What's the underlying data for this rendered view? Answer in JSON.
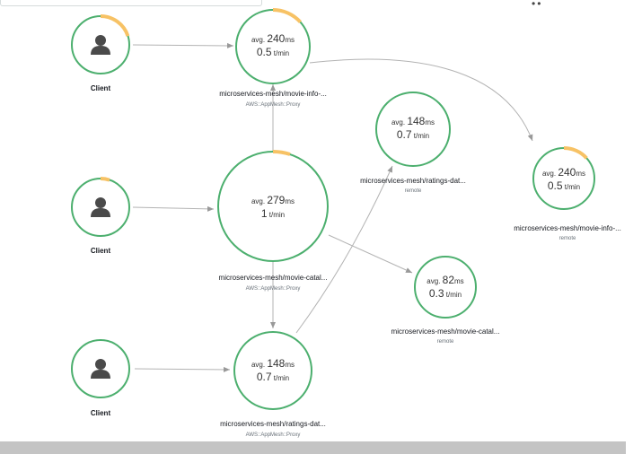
{
  "colors": {
    "healthy_ring": "#4caf6e",
    "latency_arc": "#f7c265",
    "edge": "#b3b3b3",
    "client_icon": "#4a4a4a"
  },
  "clients": [
    {
      "label": "Client",
      "icon": "user-icon"
    },
    {
      "label": "Client",
      "icon": "user-icon"
    },
    {
      "label": "Client",
      "icon": "user-icon"
    }
  ],
  "services": [
    {
      "id": "movie-info-proxy",
      "avg_prefix": "avg.",
      "avg_value": "240",
      "avg_unit": "ms",
      "rate_value": "0.5",
      "rate_unit": "t/min",
      "name": "microservices-mesh/movie-info-...",
      "type": "AWS::AppMesh::Proxy"
    },
    {
      "id": "movie-catalog-proxy",
      "avg_prefix": "avg.",
      "avg_value": "279",
      "avg_unit": "ms",
      "rate_value": "1",
      "rate_unit": "t/min",
      "name": "microservices-mesh/movie-catal...",
      "type": "AWS::AppMesh::Proxy"
    },
    {
      "id": "ratings-proxy",
      "avg_prefix": "avg.",
      "avg_value": "148",
      "avg_unit": "ms",
      "rate_value": "0.7",
      "rate_unit": "t/min",
      "name": "microservices-mesh/ratings-dat...",
      "type": "AWS::AppMesh::Proxy"
    },
    {
      "id": "ratings-remote",
      "avg_prefix": "avg.",
      "avg_value": "148",
      "avg_unit": "ms",
      "rate_value": "0.7",
      "rate_unit": "t/min",
      "name": "microservices-mesh/ratings-dat...",
      "type": "remote"
    },
    {
      "id": "movie-info-remote",
      "avg_prefix": "avg.",
      "avg_value": "240",
      "avg_unit": "ms",
      "rate_value": "0.5",
      "rate_unit": "t/min",
      "name": "microservices-mesh/movie-info-...",
      "type": "remote"
    },
    {
      "id": "movie-catalog-remote",
      "avg_prefix": "avg.",
      "avg_value": "82",
      "avg_unit": "ms",
      "rate_value": "0.3",
      "rate_unit": "t/min",
      "name": "microservices-mesh/movie-catal...",
      "type": "remote"
    }
  ]
}
